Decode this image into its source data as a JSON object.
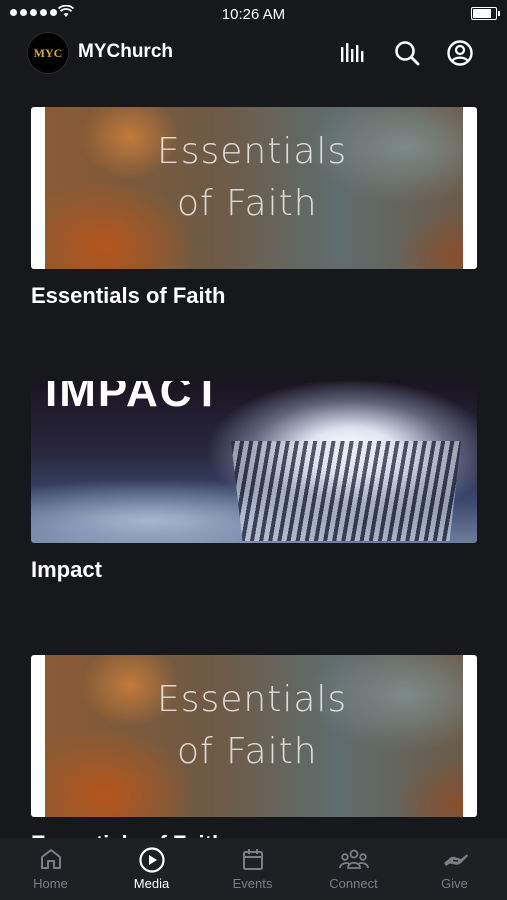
{
  "status_bar": {
    "time": "10:26 AM",
    "battery_fraction": 0.9
  },
  "header": {
    "logo_text": "MYC",
    "title": "MYChurch"
  },
  "media_items": [
    {
      "title": "Essentials of Faith",
      "thumb_text_line1": "Essentials",
      "thumb_text_line2": "of Faith"
    },
    {
      "title": "Impact",
      "thumb_text": "IMPACT"
    },
    {
      "title": "Essentials of Faith",
      "thumb_text_line1": "Essentials",
      "thumb_text_line2": "of Faith"
    }
  ],
  "tabs": [
    {
      "label": "Home",
      "icon": "home-icon",
      "active": false
    },
    {
      "label": "Media",
      "icon": "play-circle-icon",
      "active": true
    },
    {
      "label": "Events",
      "icon": "calendar-icon",
      "active": false
    },
    {
      "label": "Connect",
      "icon": "people-icon",
      "active": false
    },
    {
      "label": "Give",
      "icon": "hand-icon",
      "active": false
    }
  ],
  "colors": {
    "background": "#16181b",
    "tabbar": "#1e2024",
    "inactive": "#7d7f84",
    "active": "#ffffff"
  }
}
